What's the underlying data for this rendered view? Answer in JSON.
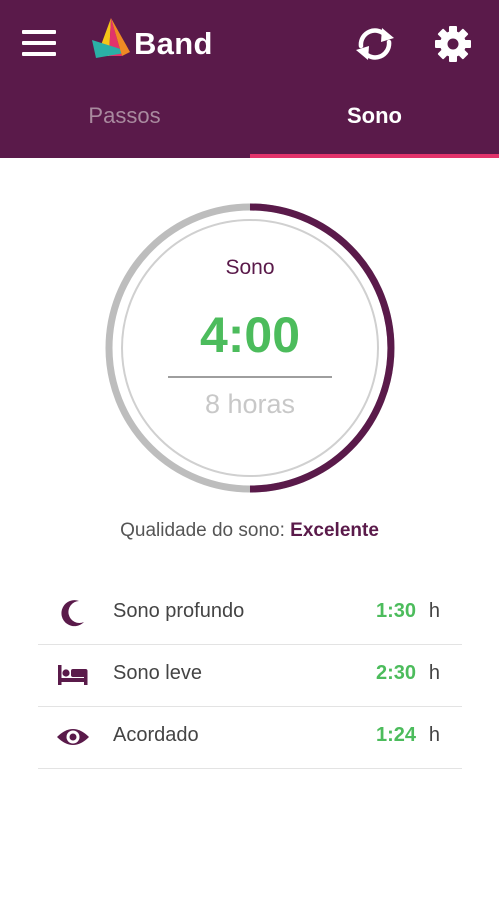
{
  "app": {
    "name": "Band"
  },
  "tabs": [
    {
      "label": "Passos",
      "active": false
    },
    {
      "label": "Sono",
      "active": true
    }
  ],
  "colors": {
    "brand": "#5a1a4a",
    "accent_pink": "#e2336b",
    "value_green": "#4cbc5c",
    "ring_track": "#bdbdbd"
  },
  "summary": {
    "label": "Sono",
    "time": "4:00",
    "goal": "8 horas",
    "progress_fraction": 0.5
  },
  "quality": {
    "prefix": "Qualidade do sono: ",
    "value": "Excelente"
  },
  "stages": [
    {
      "icon": "moon-icon",
      "label": "Sono profundo",
      "value": "1:30",
      "unit": "h"
    },
    {
      "icon": "bed-icon",
      "label": "Sono leve",
      "value": "2:30",
      "unit": "h"
    },
    {
      "icon": "eye-icon",
      "label": "Acordado",
      "value": "1:24",
      "unit": "h"
    }
  ]
}
